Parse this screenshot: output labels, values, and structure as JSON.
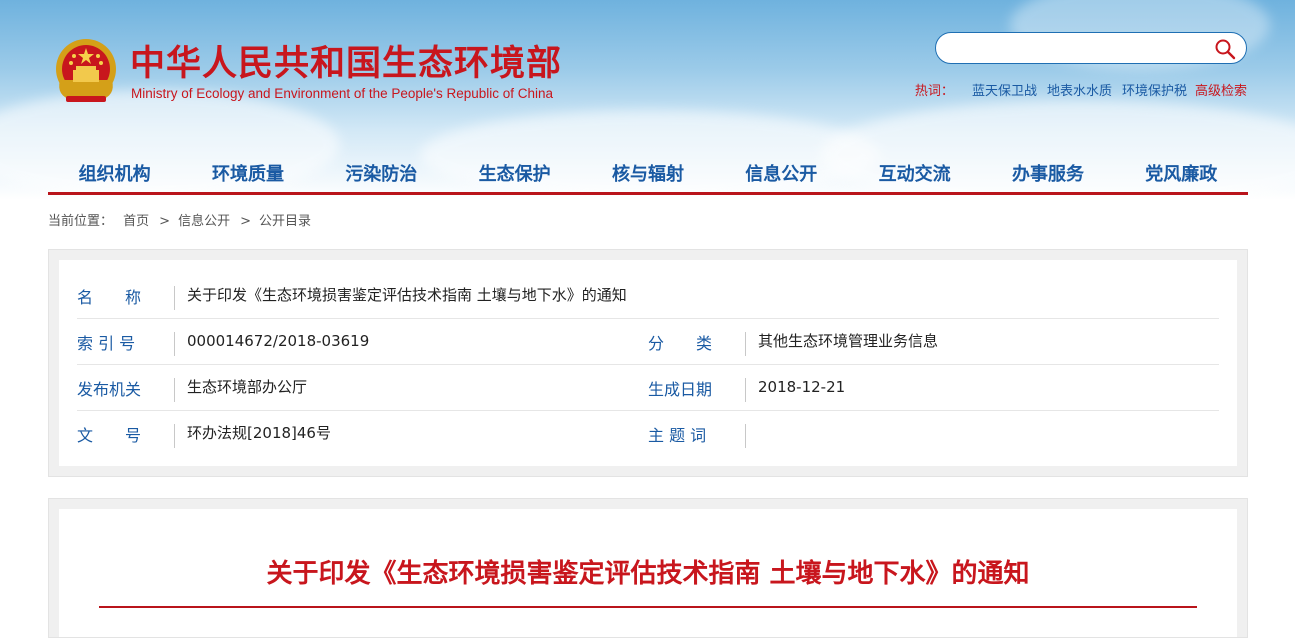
{
  "header": {
    "title": "中华人民共和国生态环境部",
    "subtitle": "Ministry of Ecology and Environment of the People's Republic of China"
  },
  "search": {
    "placeholder": "",
    "hot_label": "热词：",
    "hot_words": [
      "蓝天保卫战",
      "地表水水质",
      "环境保护税"
    ],
    "advanced": "高级检索"
  },
  "nav": [
    "组织机构",
    "环境质量",
    "污染防治",
    "生态保护",
    "核与辐射",
    "信息公开",
    "互动交流",
    "办事服务",
    "党风廉政"
  ],
  "breadcrumb": {
    "label": "当前位置：",
    "items": [
      "首页",
      "信息公开",
      "公开目录"
    ],
    "separator": ">"
  },
  "info": {
    "name_label": "名　　称",
    "name_value": "关于印发《生态环境损害鉴定评估技术指南 土壤与地下水》的通知",
    "index_label": "索 引 号",
    "index_value": "000014672/2018-03619",
    "category_label": "分　　类",
    "category_value": "其他生态环境管理业务信息",
    "issuer_label": "发布机关",
    "issuer_value": "生态环境部办公厅",
    "date_label": "生成日期",
    "date_value": "2018-12-21",
    "docno_label": "文　　号",
    "docno_value": "环办法规[2018]46号",
    "keywords_label": "主 题 词",
    "keywords_value": ""
  },
  "document": {
    "title": "关于印发《生态环境损害鉴定评估技术指南 土壤与地下水》的通知"
  },
  "colors": {
    "brand_red": "#c8161d",
    "link_blue": "#1a5aa3"
  }
}
